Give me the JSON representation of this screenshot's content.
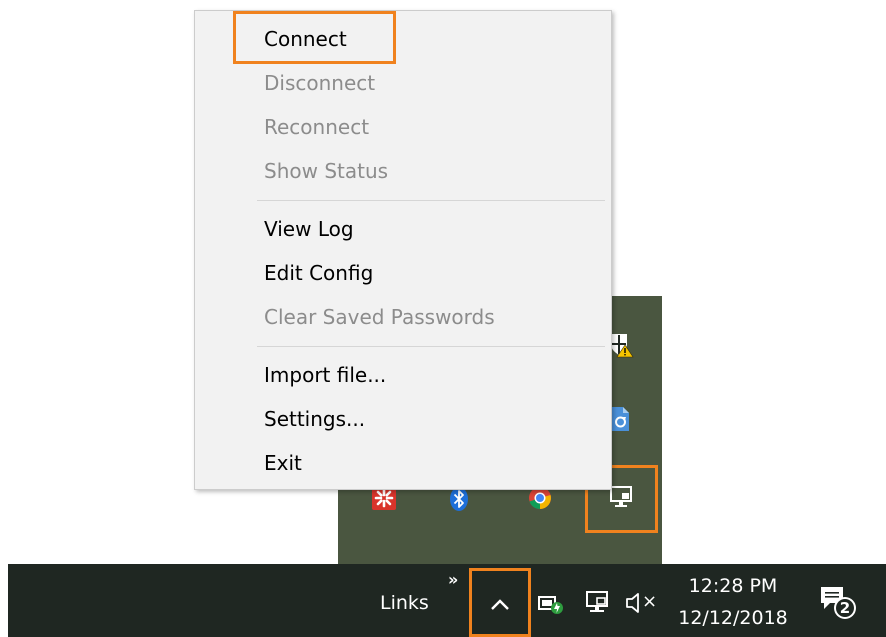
{
  "context_menu": {
    "items": [
      {
        "label": "Connect",
        "enabled": true
      },
      {
        "label": "Disconnect",
        "enabled": false
      },
      {
        "label": "Reconnect",
        "enabled": false
      },
      {
        "label": "Show Status",
        "enabled": false
      },
      {
        "label": "View Log",
        "enabled": true
      },
      {
        "label": "Edit Config",
        "enabled": true
      },
      {
        "label": "Clear Saved Passwords",
        "enabled": false
      },
      {
        "label": "Import file...",
        "enabled": true
      },
      {
        "label": "Settings...",
        "enabled": true
      },
      {
        "label": "Exit",
        "enabled": true
      }
    ]
  },
  "tray_flyout": {
    "icons": [
      "windows-defender-warning-icon",
      "file-sync-icon",
      "red-app-icon",
      "bluetooth-icon",
      "chrome-icon",
      "openvpn-monitor-icon"
    ]
  },
  "taskbar": {
    "links_label": "Links",
    "overflow_chevron": "»",
    "show_hidden_icons_glyph": "^",
    "volume_glyph": "×",
    "clock": {
      "time": "12:28 PM",
      "date": "12/12/2018"
    },
    "notification_count": "2"
  },
  "colors": {
    "highlight": "#f0821e",
    "menu_background": "#f2f2f2",
    "menu_disabled_text": "#8c8c8c",
    "flyout_background": "#4a5640",
    "taskbar_background": "#1f2722"
  }
}
